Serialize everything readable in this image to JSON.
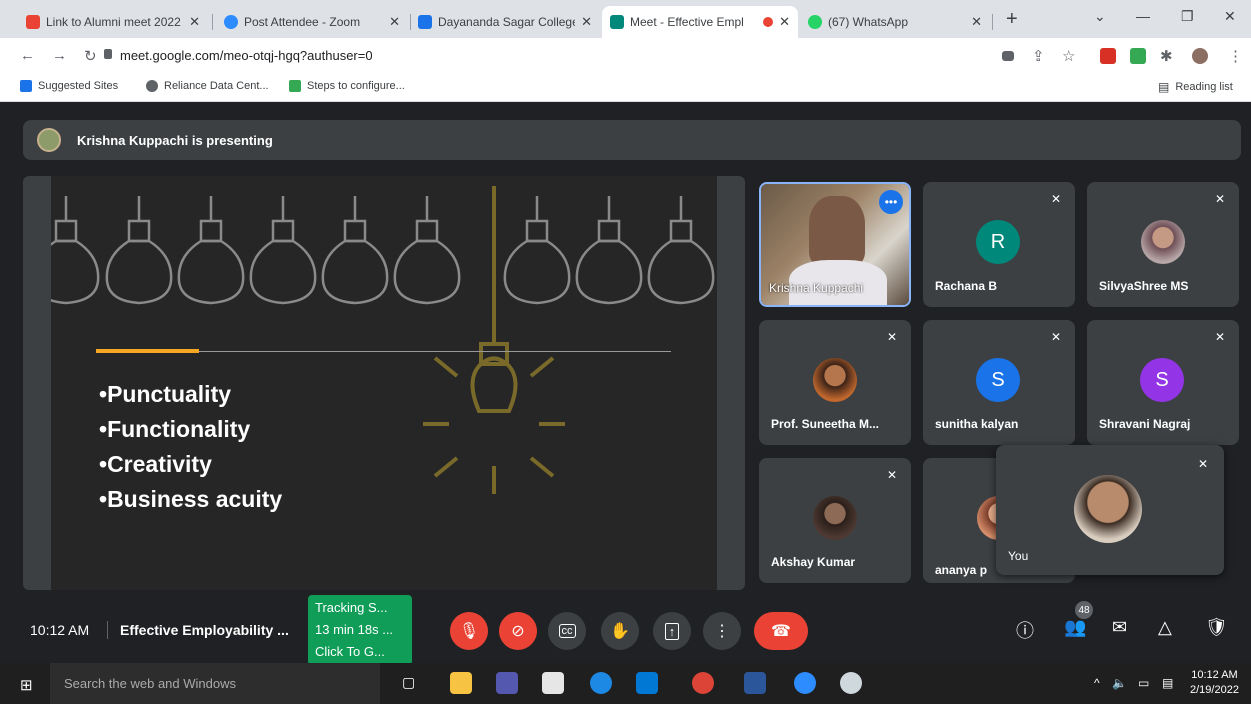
{
  "browser": {
    "tabs": [
      {
        "title": "Link to Alumni meet 2022",
        "color": "#ea4335"
      },
      {
        "title": "Post Attendee - Zoom",
        "color": "#2d8cff"
      },
      {
        "title": "Dayananda Sagar College",
        "color": "#1a73e8"
      },
      {
        "title": "Meet - Effective Empl",
        "color": "#00897b",
        "active": true
      },
      {
        "title": "(67) WhatsApp",
        "color": "#25d366"
      }
    ],
    "url": "meet.google.com/meo-otqj-hgq?authuser=0",
    "bookmarks": [
      {
        "label": "Suggested Sites",
        "color": "#1a73e8"
      },
      {
        "label": "Reliance Data Cent...",
        "color": "#5f6368"
      },
      {
        "label": "Steps to configure...",
        "color": "#34a853"
      }
    ],
    "reading_list": "Reading list"
  },
  "meet": {
    "presenting_text": "Krishna Kuppachi is presenting",
    "slide": {
      "bullets": [
        "Punctuality",
        "Functionality",
        "Creativity",
        "Business acuity"
      ]
    },
    "participants": [
      {
        "name": "Krishna Kuppachi",
        "type": "video"
      },
      {
        "name": "Rachana B",
        "letter": "R",
        "color": "#00897b"
      },
      {
        "name": "SilvyaShree MS",
        "type": "photo",
        "color": "#b7a7a8"
      },
      {
        "name": "Prof. Suneetha M...",
        "type": "photo",
        "color": "#c2682d"
      },
      {
        "name": "sunitha kalyan",
        "letter": "S",
        "color": "#1a73e8"
      },
      {
        "name": "Shravani Nagraj",
        "letter": "S",
        "color": "#9334e6"
      },
      {
        "name": "Akshay Kumar",
        "type": "photo",
        "color": "#4e3a33"
      },
      {
        "name": "ananya p",
        "type": "photo",
        "color": "#d88f6c"
      }
    ],
    "self_label": "You",
    "more_glyph": "•••",
    "mute_glyph": "✕"
  },
  "bottom": {
    "time": "10:12 AM",
    "meeting_title": "Effective Employability ...",
    "tracking": [
      "Tracking S...",
      "13 min 18s ...",
      "Click To G..."
    ],
    "participant_count": "48"
  },
  "taskbar": {
    "search_placeholder": "Search the web and Windows",
    "time": "10:12 AM",
    "date": "2/19/2022"
  }
}
